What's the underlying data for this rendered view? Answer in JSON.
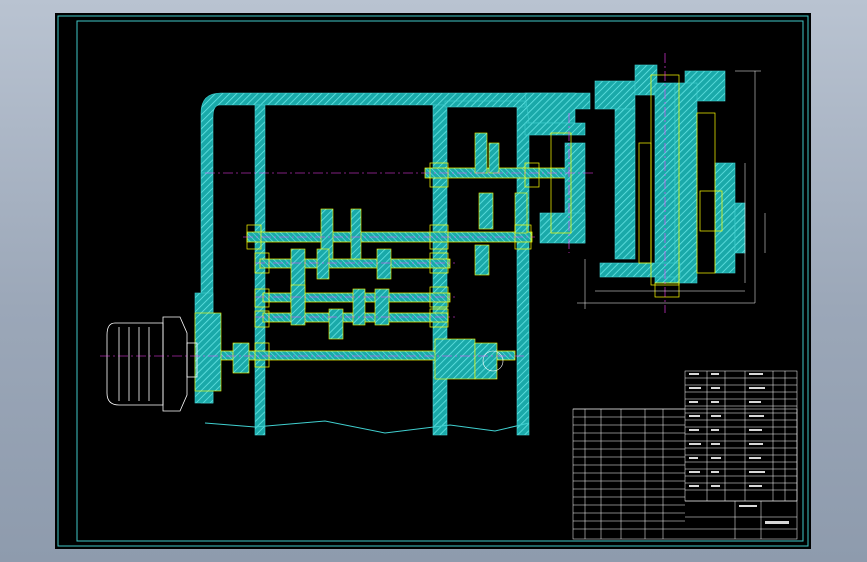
{
  "drawing": {
    "background_color": "#000000",
    "frame_color": "#40c8c8",
    "hatch_color": "#2fbfbf",
    "part_outline_color": "#ffff00",
    "centerline_color": "#ff00ff",
    "dimension_color": "#ffffff",
    "view": "section"
  },
  "title_block": {
    "line_color": "#ffffff",
    "parts_list_rows": 18,
    "revision_rows": 14
  }
}
